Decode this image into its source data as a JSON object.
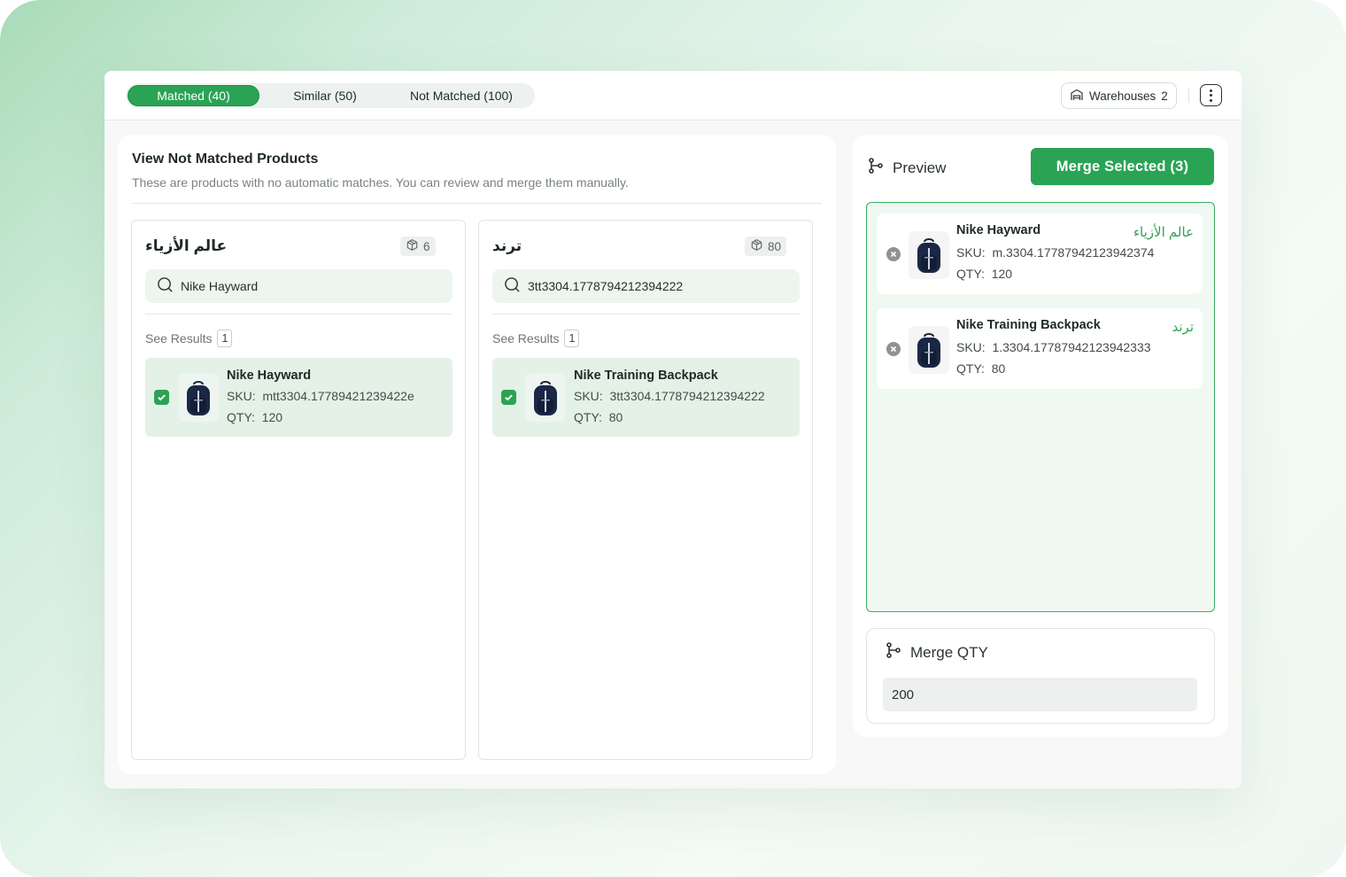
{
  "tabs": [
    {
      "label": "Matched (40)",
      "active": true
    },
    {
      "label": "Similar (50)",
      "active": false
    },
    {
      "label": "Not Matched (100)",
      "active": false
    }
  ],
  "header": {
    "warehouses_label": "Warehouses",
    "warehouses_count": "2",
    "more_icon": "kebab-vertical-icon"
  },
  "left_panel": {
    "title": "View Not Matched Products",
    "subtitle": "These are products with no automatic matches. You can review and merge them manually.",
    "columns": [
      {
        "name": "عالم الأزياء",
        "count": "6",
        "search_value": "Nike Hayward",
        "see_results_label": "See Results",
        "results_count": "1",
        "result": {
          "checked": true,
          "name": "Nike Hayward",
          "sku_label": "SKU:",
          "sku": "mtt3304.17789421239422e",
          "qty_label": "QTY:",
          "qty": "120"
        }
      },
      {
        "name": "ترند",
        "count": "80",
        "search_value": "3tt3304.1778794212394222",
        "see_results_label": "See Results",
        "results_count": "1",
        "result": {
          "checked": true,
          "name": "Nike Training Backpack",
          "sku_label": "SKU:",
          "sku": "3tt3304.1778794212394222",
          "qty_label": "QTY:",
          "qty": "80"
        }
      }
    ]
  },
  "right_panel": {
    "preview_label": "Preview",
    "merge_button": "Merge Selected (3)",
    "preview_items": [
      {
        "name": "Nike Hayward",
        "store": "عالم الأزياء",
        "sku_label": "SKU:",
        "sku": "m.3304.17787942123942374",
        "qty_label": "QTY:",
        "qty": "120"
      },
      {
        "name": "Nike Training Backpack",
        "store": "ترند",
        "sku_label": "SKU:",
        "sku": "1.3304.17787942123942333",
        "qty_label": "QTY:",
        "qty": "80"
      }
    ],
    "merge_qty_label": "Merge QTY",
    "merge_qty_value": "200"
  },
  "colors": {
    "accent": "#2aa355",
    "accent_light": "#e4f1e7",
    "text": "#1f2a24"
  }
}
